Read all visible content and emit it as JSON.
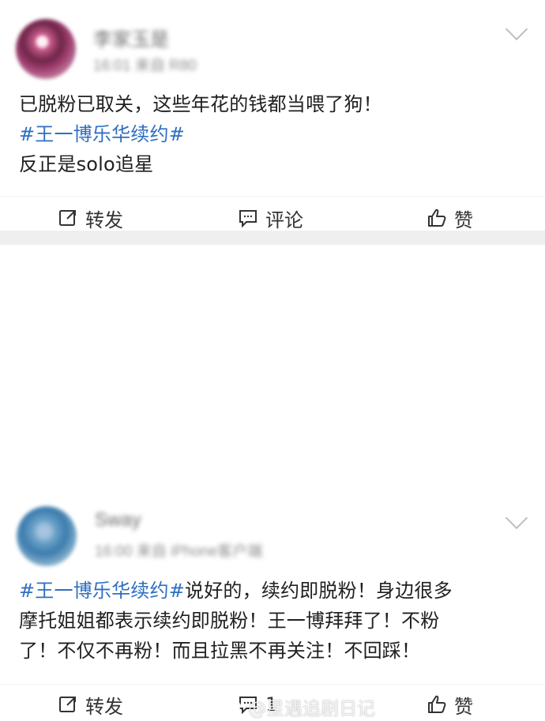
{
  "posts": [
    {
      "author_name": "李家玉是",
      "meta": "16:01 来自 R80",
      "content": {
        "line1": "已脱粉已取关，这些年花的钱都当喂了狗！",
        "line2_hashtag": "#王一博乐华续约#",
        "line3": "反正是solo追星"
      },
      "actions": {
        "repost": "转发",
        "comment": "评论",
        "like": "赞"
      }
    },
    {
      "author_name": "Sway",
      "meta": "16:00 来自 iPhone客户端",
      "content": {
        "line1_hashtag": "#王一博乐华续约#",
        "line1_text": "说好的，续约即脱粉！身边很多",
        "line2": "摩托姐姐都表示续约即脱粉！王一博拜拜了！不粉",
        "line3": "了！不仅不再粉！而且拉黑不再关注！不回踩！"
      },
      "actions": {
        "repost": "转发",
        "comment": "1",
        "like": "赞"
      }
    }
  ],
  "watermark": {
    "text": "@星遇追剧日记"
  },
  "icons": {
    "repost": "repost-icon",
    "comment": "comment-icon",
    "like": "thumbs-up-icon",
    "menu": "chevron-down-icon",
    "watermark": "weibo-icon"
  },
  "colors": {
    "hashtag": "#2f6fc0",
    "text": "#202020",
    "icon": "#333333",
    "separator": "#efefef"
  }
}
